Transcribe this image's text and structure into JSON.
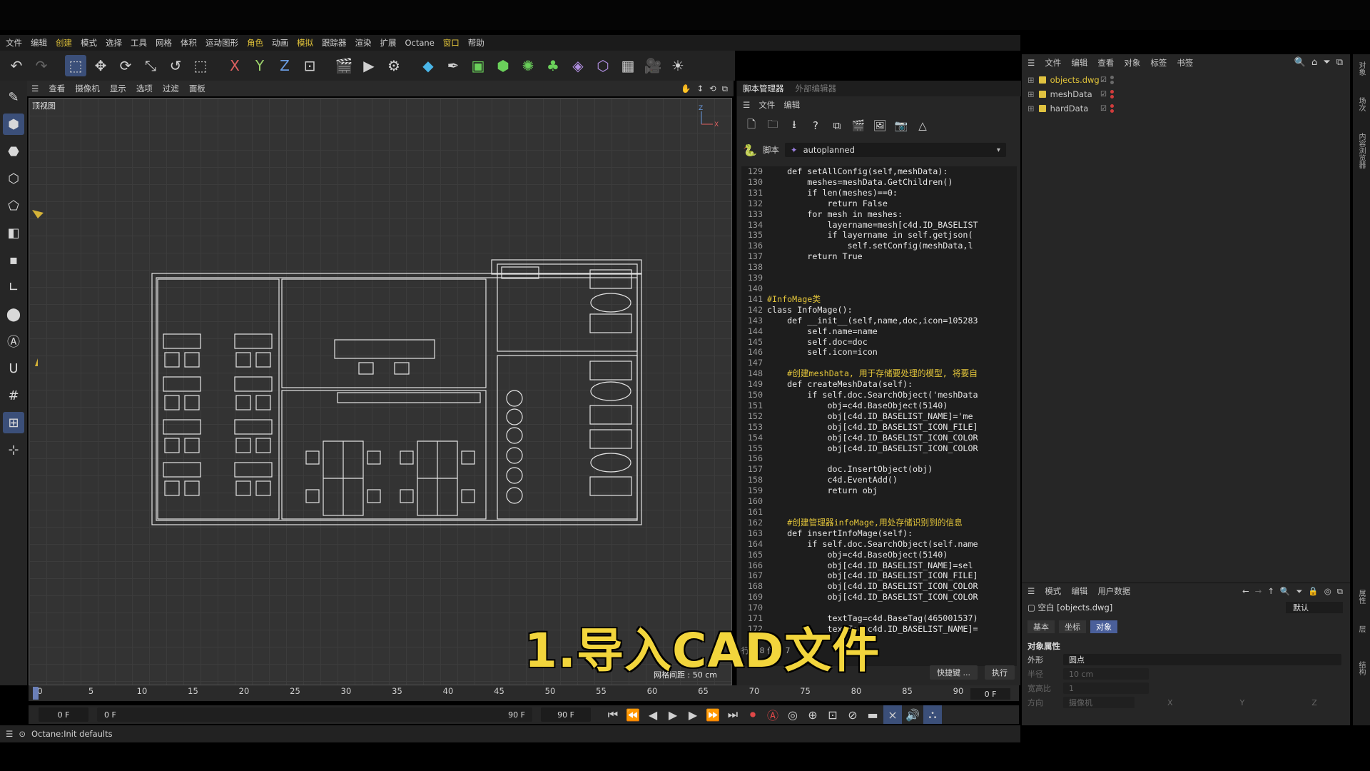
{
  "menubar": [
    "文件",
    "编辑",
    "创建",
    "模式",
    "选择",
    "工具",
    "网格",
    "体积",
    "运动图形",
    "角色",
    "动画",
    "模拟",
    "跟踪器",
    "渲染",
    "扩展",
    "Octane",
    "窗口",
    "帮助"
  ],
  "toolbar": {
    "icons": [
      "undo-icon",
      "redo-icon",
      "select-icon",
      "move-icon",
      "rotate-icon",
      "scale-icon",
      "loop-icon",
      "live-select-icon",
      "x-axis-icon",
      "y-axis-icon",
      "z-axis-icon",
      "world-icon",
      "render-region-icon",
      "render-view-icon",
      "render-settings-icon",
      "cube-icon",
      "pen-icon",
      "subdivision-icon",
      "extrude-icon",
      "mograph-icon",
      "array-icon",
      "deformer-icon",
      "field-icon",
      "grid-icon",
      "camera-icon",
      "light-icon"
    ],
    "axis_labels": [
      "X",
      "Y",
      "Z"
    ]
  },
  "viewport": {
    "menu": [
      "查看",
      "摄像机",
      "显示",
      "选项",
      "过滤",
      "面板"
    ],
    "label": "顶视图",
    "grid_spacing": "网格间距 : 50 cm"
  },
  "timeline": {
    "ticks": [
      "0",
      "5",
      "10",
      "15",
      "20",
      "25",
      "30",
      "35",
      "40",
      "45",
      "50",
      "55",
      "60",
      "65",
      "70",
      "75",
      "80",
      "85",
      "90"
    ],
    "current_frame_right": "0 F"
  },
  "transport": {
    "start": "0 F",
    "min": "0 F",
    "max": "90 F",
    "end": "90 F"
  },
  "status": "Octane:Init defaults",
  "script_manager": {
    "tabs": [
      "脚本管理器",
      "外部编辑器"
    ],
    "menu": [
      "文件",
      "编辑"
    ],
    "script_label": "脚本",
    "script_name": "autoplanned",
    "buttons": [
      "快捷键 ...",
      "执行"
    ],
    "overlay_text": "行数 8      位置 7",
    "code": [
      {
        "n": "129",
        "t": "    def setAllConfig(self,meshData):"
      },
      {
        "n": "130",
        "t": "        meshes=meshData.GetChildren()"
      },
      {
        "n": "131",
        "t": "        if len(meshes)==0:"
      },
      {
        "n": "132",
        "t": "            return False"
      },
      {
        "n": "133",
        "t": "        for mesh in meshes:"
      },
      {
        "n": "134",
        "t": "            layername=mesh[c4d.ID_BASELIST"
      },
      {
        "n": "135",
        "t": "            if layername in self.getjson("
      },
      {
        "n": "136",
        "t": "                self.setConfig(meshData,l"
      },
      {
        "n": "137",
        "t": "        return True"
      },
      {
        "n": "138",
        "t": ""
      },
      {
        "n": "139",
        "t": ""
      },
      {
        "n": "140",
        "t": ""
      },
      {
        "n": "141",
        "t": "#InfoMage类"
      },
      {
        "n": "142",
        "t": "class InfoMage():"
      },
      {
        "n": "143",
        "t": "    def __init__(self,name,doc,icon=105283"
      },
      {
        "n": "144",
        "t": "        self.name=name"
      },
      {
        "n": "145",
        "t": "        self.doc=doc"
      },
      {
        "n": "146",
        "t": "        self.icon=icon"
      },
      {
        "n": "147",
        "t": ""
      },
      {
        "n": "148",
        "t": "    #创建meshData, 用于存储要处理的模型, 将要自"
      },
      {
        "n": "149",
        "t": "    def createMeshData(self):"
      },
      {
        "n": "150",
        "t": "        if self.doc.SearchObject('meshData"
      },
      {
        "n": "151",
        "t": "            obj=c4d.BaseObject(5140)"
      },
      {
        "n": "152",
        "t": "            obj[c4d.ID_BASELIST_NAME]='me"
      },
      {
        "n": "153",
        "t": "            obj[c4d.ID_BASELIST_ICON_FILE]"
      },
      {
        "n": "154",
        "t": "            obj[c4d.ID_BASELIST_ICON_COLOR"
      },
      {
        "n": "155",
        "t": "            obj[c4d.ID_BASELIST_ICON_COLOR"
      },
      {
        "n": "156",
        "t": ""
      },
      {
        "n": "157",
        "t": "            doc.InsertObject(obj)"
      },
      {
        "n": "158",
        "t": "            c4d.EventAdd()"
      },
      {
        "n": "159",
        "t": "            return obj"
      },
      {
        "n": "160",
        "t": ""
      },
      {
        "n": "161",
        "t": ""
      },
      {
        "n": "162",
        "t": "    #创建管理器infoMage,用处存储识别到的信息"
      },
      {
        "n": "163",
        "t": "    def insertInfoMage(self):"
      },
      {
        "n": "164",
        "t": "        if self.doc.SearchObject(self.name"
      },
      {
        "n": "165",
        "t": "            obj=c4d.BaseObject(5140)"
      },
      {
        "n": "166",
        "t": "            obj[c4d.ID_BASELIST_NAME]=sel"
      },
      {
        "n": "167",
        "t": "            obj[c4d.ID_BASELIST_ICON_FILE]"
      },
      {
        "n": "168",
        "t": "            obj[c4d.ID_BASELIST_ICON_COLOR"
      },
      {
        "n": "169",
        "t": "            obj[c4d.ID_BASELIST_ICON_COLOR"
      },
      {
        "n": "170",
        "t": ""
      },
      {
        "n": "171",
        "t": "            textTag=c4d.BaseTag(465001537)"
      },
      {
        "n": "172",
        "t": "            textTag[c4d.ID_BASELIST_NAME]="
      }
    ]
  },
  "object_manager": {
    "menu": [
      "文件",
      "编辑",
      "查看",
      "对象",
      "标签",
      "书签"
    ],
    "objects": [
      "objects.dwg",
      "meshData",
      "hardData"
    ]
  },
  "attributes": {
    "menu": [
      "模式",
      "编辑",
      "用户数据"
    ],
    "object_line": "空白 [objects.dwg]",
    "preset": "默认",
    "tabs": [
      "基本",
      "坐标",
      "对象"
    ],
    "section": "对象属性",
    "rows": [
      {
        "label": "外形",
        "value": "圆点"
      },
      {
        "label": "半径",
        "value": "10 cm"
      },
      {
        "label": "宽高比",
        "value": "1"
      },
      {
        "label": "方向",
        "value": "摄像机"
      }
    ],
    "axis_cols": [
      "X",
      "Y",
      "Z"
    ]
  },
  "right_strip_labels": [
    "对象",
    "场次",
    "内容浏览器",
    "属性",
    "层",
    "结构"
  ],
  "subtitle": "1.导入CAD文件",
  "colors": {
    "accent": "#3b4f79",
    "highlight": "#e3c53a",
    "subtitle": "#f2d53c",
    "string": "#f0b93c",
    "comment": "#e3c53a",
    "keyword": "#e6e6e6"
  }
}
